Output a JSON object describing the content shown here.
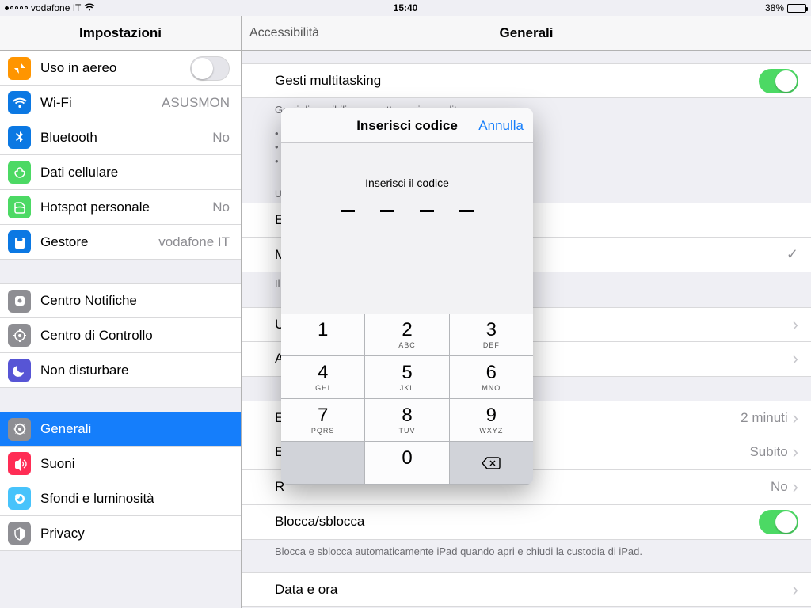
{
  "statusbar": {
    "carrier": "vodafone IT",
    "time": "15:40",
    "battery_pct": "38%"
  },
  "sidebar": {
    "title": "Impostazioni",
    "items": [
      {
        "label": "Uso in aereo",
        "color": "#ff9500",
        "value": "",
        "switch": "off"
      },
      {
        "label": "Wi-Fi",
        "color": "#0b78e3",
        "value": "ASUSMON"
      },
      {
        "label": "Bluetooth",
        "color": "#0b78e3",
        "value": "No"
      },
      {
        "label": "Dati cellulare",
        "color": "#4cd964",
        "value": ""
      },
      {
        "label": "Hotspot personale",
        "color": "#4cd964",
        "value": "No"
      },
      {
        "label": "Gestore",
        "color": "#0b78e3",
        "value": "vodafone IT"
      },
      {
        "label": "Centro Notifiche",
        "color": "#8e8e93"
      },
      {
        "label": "Centro di Controllo",
        "color": "#8e8e93"
      },
      {
        "label": "Non disturbare",
        "color": "#5755d5"
      },
      {
        "label": "Generali",
        "color": "#8e8e93",
        "selected": true
      },
      {
        "label": "Suoni",
        "color": "#ff2d55"
      },
      {
        "label": "Sfondi e luminosità",
        "color": "#47c3fb"
      },
      {
        "label": "Privacy",
        "color": "#8e8e93"
      }
    ]
  },
  "detail": {
    "back": "Accessibilità",
    "title": "Generali",
    "gesti": "Gesti multitasking",
    "gesti_desc": "Gesti disponibili con quattro o cinque dita:",
    "usa_header": "USA",
    "row_e": "E",
    "row_m": "M",
    "footnote_controllo": "Il                                                                                              Controllo.",
    "row_u": "U",
    "row_a": "A",
    "row_eb": "E",
    "row_eb_val": "2 minuti",
    "row_ec": "E",
    "row_ec_val": "Subito",
    "row_r": "R",
    "row_r_val": "No",
    "blocca": "Blocca/sblocca",
    "blocca_desc": "Blocca e sblocca automaticamente iPad quando apri e chiudi la custodia di iPad.",
    "dataora": "Data e ora"
  },
  "modal": {
    "title": "Inserisci codice",
    "cancel": "Annulla",
    "prompt": "Inserisci il codice",
    "keys": [
      {
        "n": "1",
        "l": ""
      },
      {
        "n": "2",
        "l": "ABC"
      },
      {
        "n": "3",
        "l": "DEF"
      },
      {
        "n": "4",
        "l": "GHI"
      },
      {
        "n": "5",
        "l": "JKL"
      },
      {
        "n": "6",
        "l": "MNO"
      },
      {
        "n": "7",
        "l": "PQRS"
      },
      {
        "n": "8",
        "l": "TUV"
      },
      {
        "n": "9",
        "l": "WXYZ"
      },
      {
        "blank": true
      },
      {
        "n": "0",
        "l": ""
      },
      {
        "back": true
      }
    ]
  }
}
